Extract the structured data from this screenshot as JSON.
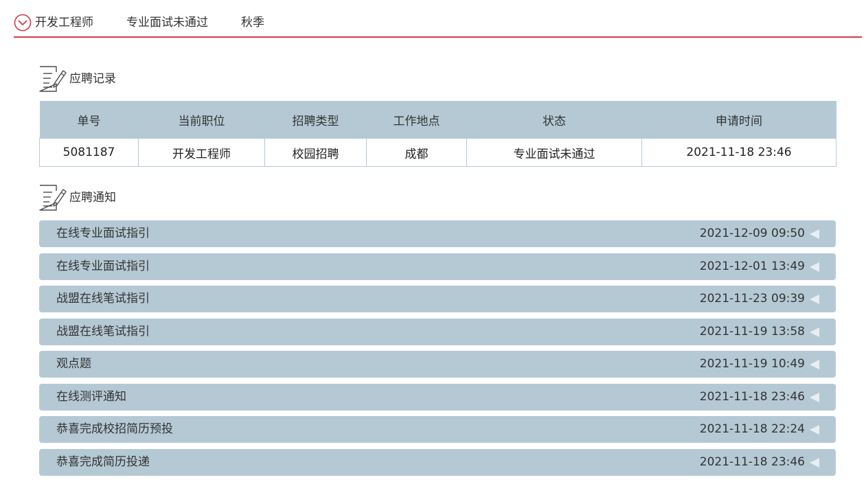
{
  "header": {
    "position": "开发工程师",
    "status": "专业面试未通过",
    "season": "秋季",
    "toggle_icon": "chevron-down-circle-icon",
    "accent_color": "#d23a4b"
  },
  "records": {
    "title": "应聘记录",
    "icon": "document-edit-icon",
    "columns": [
      "单号",
      "当前职位",
      "招聘类型",
      "工作地点",
      "状态",
      "申请时间"
    ],
    "rows": [
      [
        "5081187",
        "开发工程师",
        "校园招聘",
        "成都",
        "专业面试未通过",
        "2021-11-18 23:46"
      ]
    ]
  },
  "notices": {
    "title": "应聘通知",
    "icon": "document-edit-icon",
    "items": [
      {
        "title": "在线专业面试指引",
        "time": "2021-12-09 09:50"
      },
      {
        "title": "在线专业面试指引",
        "time": "2021-12-01 13:49"
      },
      {
        "title": "战盟在线笔试指引",
        "time": "2021-11-23 09:39"
      },
      {
        "title": "战盟在线笔试指引",
        "time": "2021-11-19 13:58"
      },
      {
        "title": "观点题",
        "time": "2021-11-19 10:49"
      },
      {
        "title": "在线测评通知",
        "time": "2021-11-18 23:46"
      },
      {
        "title": "恭喜完成校招简历预投",
        "time": "2021-11-18 22:24"
      },
      {
        "title": "恭喜完成简历投递",
        "time": "2021-11-18 23:46"
      }
    ]
  },
  "colors": {
    "row_background": "#b5c9d5",
    "accent": "#d23a4b"
  }
}
